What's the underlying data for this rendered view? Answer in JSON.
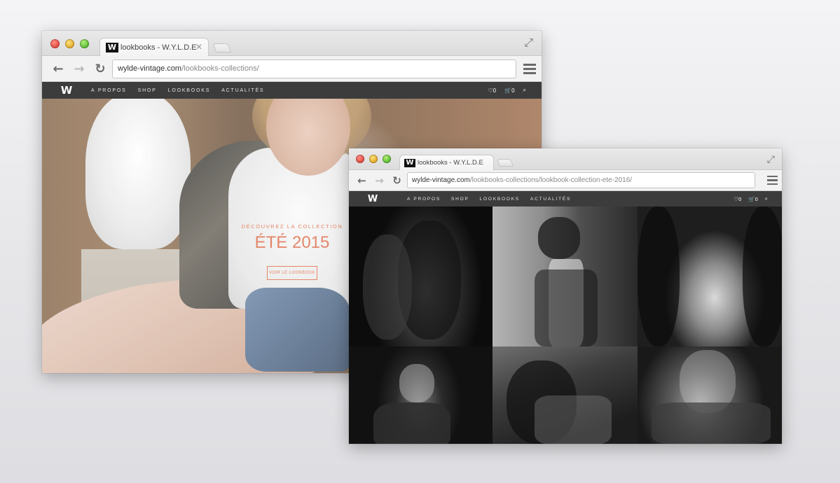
{
  "back_window": {
    "tab": {
      "logo": "W",
      "title": "lookbooks - W.Y.L.D.E",
      "close": "✕"
    },
    "url": {
      "host": "wylde-vintage.com",
      "path": "/lookbooks-collections/"
    },
    "nav": {
      "logo": "W",
      "links": [
        "A PROPOS",
        "SHOP",
        "LOOKBOOKS",
        "ACTUALITÉS"
      ],
      "wishlist_count": "0",
      "cart_count": "0"
    },
    "hero": {
      "kicker": "DÉCOUVREZ LA COLLECTION",
      "title": "ÉTÉ 2015",
      "cta": "VOIR LE LOOKBOOK"
    }
  },
  "front_window": {
    "tab": {
      "logo": "W",
      "title": "lookbooks - W.Y.L.D.E"
    },
    "url": {
      "host": "wylde-vintage.com",
      "path": "/lookbooks-collections/lookbook-collection-ete-2016/"
    },
    "nav": {
      "logo": "W",
      "links": [
        "A PROPOS",
        "SHOP",
        "LOOKBOOKS",
        "ACTUALITÉS"
      ],
      "wishlist_count": "0",
      "cart_count": "0"
    }
  },
  "icons": {
    "back": "←",
    "forward": "→",
    "reload": "↻",
    "expand": "⤢",
    "heart": "♡",
    "cart": "🛒",
    "search": "⌕"
  },
  "colors": {
    "accent": "#e4876a",
    "nav_bg": "#3c3c3c"
  }
}
